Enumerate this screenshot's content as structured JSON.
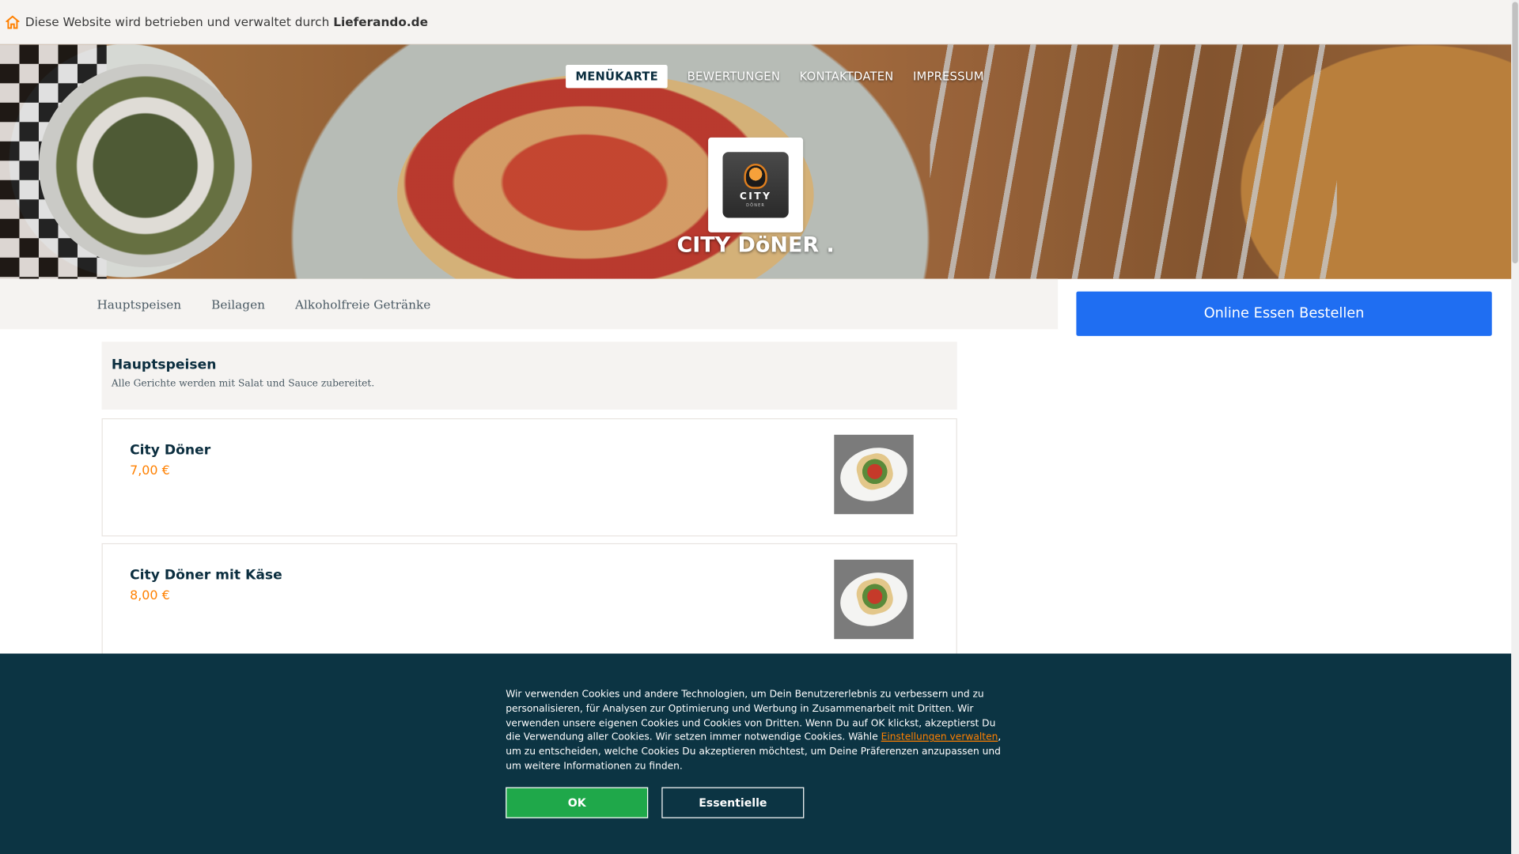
{
  "topbar": {
    "text": "Diese Website wird betrieben und verwaltet durch",
    "brand": "Lieferando.de"
  },
  "header": {
    "nav": [
      {
        "label": "MENÜKARTE",
        "active": true
      },
      {
        "label": "BEWERTUNGEN",
        "active": false
      },
      {
        "label": "KONTAKTDATEN",
        "active": false
      },
      {
        "label": "IMPRESSUM",
        "active": false
      }
    ],
    "logo_text": "CITY",
    "logo_subtext": "DÖNER",
    "restaurant_name": "CITY DöNER ."
  },
  "categories": [
    "Hauptspeisen",
    "Beilagen",
    "Alkoholfreie Getränke"
  ],
  "order_button": "Online Essen Bestellen",
  "section": {
    "title": "Hauptspeisen",
    "description": "Alle Gerichte werden mit Salat und Sauce zubereitet."
  },
  "items": [
    {
      "name": "City Döner",
      "price": "7,00 €"
    },
    {
      "name": "City Döner mit Käse",
      "price": "8,00 €"
    }
  ],
  "cookie": {
    "text_before": "Wir verwenden Cookies und andere Technologien, um Dein Benutzererlebnis zu verbessern und zu personalisieren, für Analysen zur Optimierung und Werbung in Zusammenarbeit mit Dritten. Wir verwenden unsere eigenen Cookies und Cookies von Dritten. Wenn Du auf OK klickst, akzeptierst Du die Verwendung aller Cookies. Wir setzen immer notwendige Cookies. Wähle ",
    "link": "Einstellungen verwalten",
    "text_after": ", um zu entscheiden, welche Cookies Du akzeptieren möchtest, um Deine Präferenzen anzupassen und um weitere Informationen zu finden.",
    "ok_label": "OK",
    "essential_label": "Essentielle"
  },
  "colors": {
    "accent_orange": "#ff8000",
    "primary_blue": "#1f6ef2",
    "cookie_bg": "#0c3443",
    "ok_green": "#1fa84a",
    "text_dark": "#0b2e3f"
  }
}
